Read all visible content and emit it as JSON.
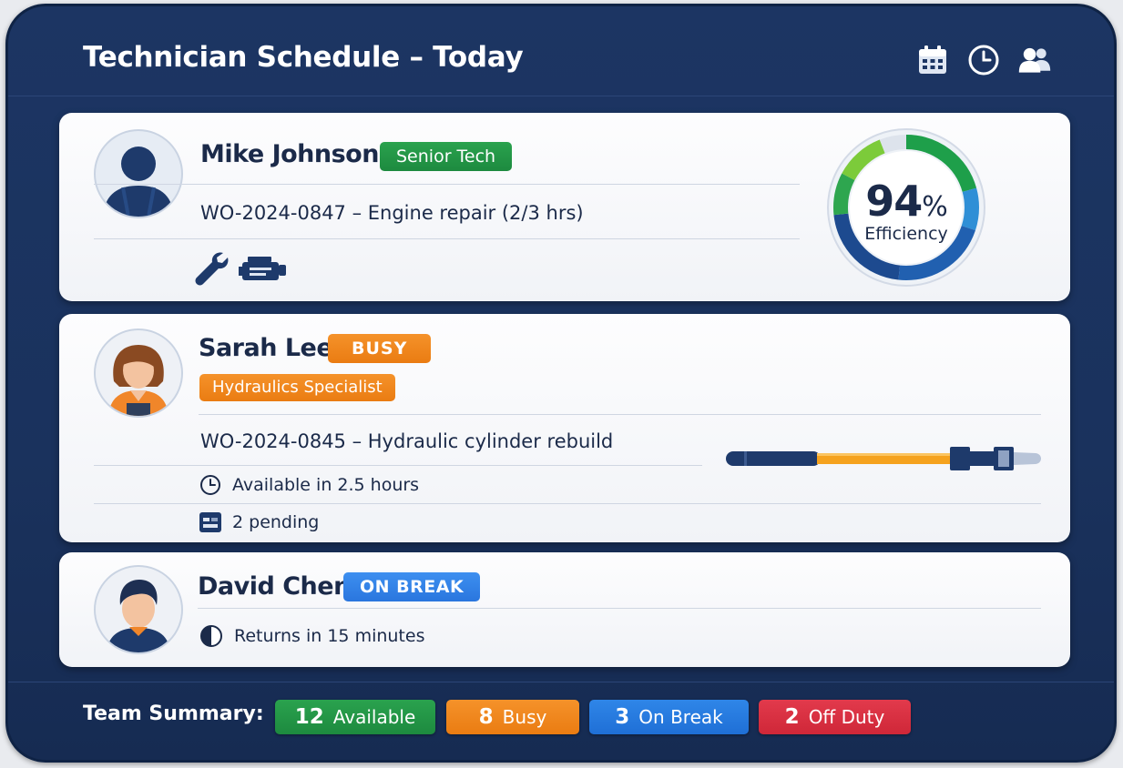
{
  "header": {
    "title": "Technician Schedule – Today",
    "icons": [
      "calendar-icon",
      "clock-icon",
      "team-icon"
    ]
  },
  "technicians": [
    {
      "name": "Mike Johnson",
      "badge": "Senior Tech",
      "work_order": "WO-2024-0847 – Engine repair (2/3 hrs)",
      "tools": [
        "wrench-icon",
        "engine-icon"
      ],
      "efficiency_value": "94",
      "efficiency_unit": "%",
      "efficiency_label": "Efficiency",
      "efficiency_fraction": 0.94
    },
    {
      "name": "Sarah Lee",
      "status": "BUSY",
      "specialty": "Hydraulics Specialist",
      "work_order": "WO-2024-0845 – Hydraulic cylinder rebuild",
      "availability": "Available in 2.5 hours",
      "pending": "2 pending"
    },
    {
      "name": "David Chen",
      "status": "ON BREAK",
      "returns": "Returns in 15 minutes"
    }
  ],
  "summary": {
    "label": "Team Summary:",
    "available": {
      "count": "12",
      "label": "Available"
    },
    "busy": {
      "count": "8",
      "label": "Busy"
    },
    "on_break": {
      "count": "3",
      "label": "On Break"
    },
    "off_duty": {
      "count": "2",
      "label": "Off Duty"
    }
  },
  "colors": {
    "navy": "#1c3563",
    "green": "#22954a",
    "orange": "#f08620",
    "blue": "#2f7fe6",
    "red": "#dc3344"
  }
}
